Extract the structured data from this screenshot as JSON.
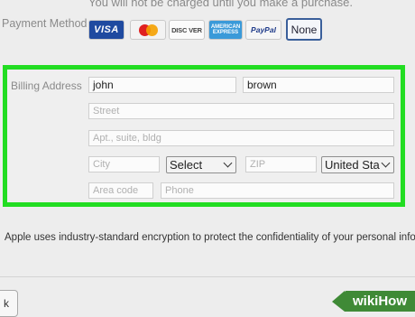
{
  "notice": {
    "text": "You will not be charged until you make a purchase."
  },
  "payment": {
    "label": "Payment Method",
    "cards": [
      {
        "name": "VISA"
      },
      {
        "name": ""
      },
      {
        "name": "DISC VER"
      },
      {
        "name": "AMERICAN EXPRESS"
      },
      {
        "name": "PayPal"
      }
    ],
    "none_label": "None"
  },
  "billing": {
    "label": "Billing Address",
    "first_name": "john",
    "last_name": "brown",
    "street_placeholder": "Street",
    "apt_placeholder": "Apt., suite, bldg",
    "city_placeholder": "City",
    "state_value": "Select",
    "zip_placeholder": "ZIP",
    "country_value": "United Sta",
    "area_code_placeholder": "Area code",
    "phone_placeholder": "Phone"
  },
  "encryption_note": "Apple uses industry-standard encryption to protect the confidentiality of your personal infor",
  "back_button": "k",
  "watermark": "wikiHow",
  "colors": {
    "highlight": "#22dd22",
    "selected_border": "#3a5f9a",
    "visa_blue": "#1f4aa0"
  }
}
